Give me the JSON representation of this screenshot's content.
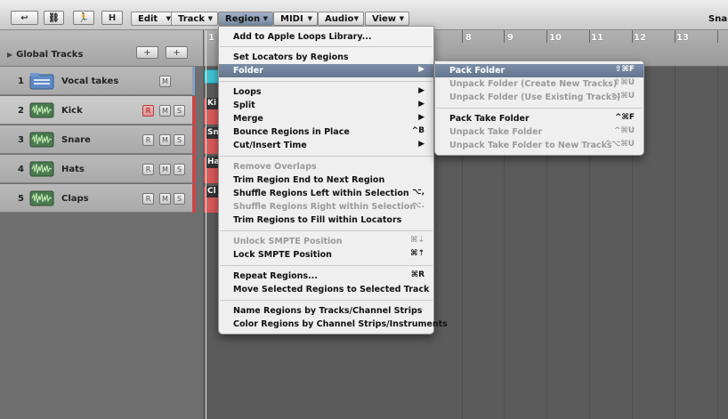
{
  "toolbar": {
    "buttons": [
      {
        "name": "back-button",
        "label": "↩"
      },
      {
        "name": "link-button",
        "label": "⛓"
      },
      {
        "name": "catch-button",
        "label": "🏃"
      },
      {
        "name": "hide-button",
        "label": "H"
      }
    ],
    "menus": [
      {
        "name": "menu-edit",
        "label": "Edit"
      },
      {
        "name": "menu-track",
        "label": "Track"
      },
      {
        "name": "menu-region",
        "label": "Region"
      },
      {
        "name": "menu-midi",
        "label": "MIDI"
      },
      {
        "name": "menu-audio",
        "label": "Audio"
      },
      {
        "name": "menu-view",
        "label": "View"
      }
    ],
    "snap_label": "Snap"
  },
  "global_tracks": {
    "label": "Global Tracks",
    "add_label": "+",
    "folder_add_label": "+"
  },
  "tracks": [
    {
      "num": "1",
      "name": "Vocal takes",
      "buttons": [
        "M"
      ]
    },
    {
      "num": "2",
      "name": "Kick",
      "buttons": [
        "R",
        "M",
        "S"
      ]
    },
    {
      "num": "3",
      "name": "Snare",
      "buttons": [
        "R",
        "M",
        "S"
      ]
    },
    {
      "num": "4",
      "name": "Hats",
      "buttons": [
        "R",
        "M",
        "S"
      ]
    },
    {
      "num": "5",
      "name": "Claps",
      "buttons": [
        "R",
        "M",
        "S"
      ]
    }
  ],
  "ruler": {
    "bars": [
      "1",
      "8",
      "9",
      "10",
      "11",
      "12",
      "13"
    ]
  },
  "regions": [
    {
      "label": "Ki"
    },
    {
      "label": "Sn"
    },
    {
      "label": "Ha"
    },
    {
      "label": "Cl"
    }
  ],
  "region_menu": {
    "items": [
      {
        "label": "Add to Apple Loops Library...",
        "shortcut": "",
        "disabled": false
      },
      {
        "sep": true
      },
      {
        "label": "Set Locators by Regions",
        "shortcut": "",
        "disabled": false
      },
      {
        "label": "Folder",
        "shortcut": "▶",
        "disabled": false,
        "highlight": true
      },
      {
        "sep": true
      },
      {
        "label": "Loops",
        "shortcut": "▶",
        "disabled": false
      },
      {
        "label": "Split",
        "shortcut": "▶",
        "disabled": false
      },
      {
        "label": "Merge",
        "shortcut": "▶",
        "disabled": false
      },
      {
        "label": "Bounce Regions in Place",
        "shortcut": "^B",
        "disabled": false
      },
      {
        "label": "Cut/Insert Time",
        "shortcut": "▶",
        "disabled": false
      },
      {
        "sep": true
      },
      {
        "label": "Remove Overlaps",
        "shortcut": "",
        "disabled": true
      },
      {
        "label": "Trim Region End to Next Region",
        "shortcut": "",
        "disabled": false
      },
      {
        "label": "Shuffle Regions Left within Selection",
        "shortcut": "⌥,",
        "disabled": false
      },
      {
        "label": "Shuffle Regions Right within Selection",
        "shortcut": "⌥.",
        "disabled": true
      },
      {
        "label": "Trim Regions to Fill within Locators",
        "shortcut": "",
        "disabled": false
      },
      {
        "sep": true
      },
      {
        "label": "Unlock SMPTE Position",
        "shortcut": "⌘⇣",
        "disabled": true
      },
      {
        "label": "Lock SMPTE Position",
        "shortcut": "⌘⇡",
        "disabled": false
      },
      {
        "sep": true
      },
      {
        "label": "Repeat Regions...",
        "shortcut": "⌘R",
        "disabled": false
      },
      {
        "label": "Move Selected Regions to Selected Track",
        "shortcut": "",
        "disabled": false
      },
      {
        "sep": true
      },
      {
        "label": "Name Regions by Tracks/Channel Strips",
        "shortcut": "",
        "disabled": false
      },
      {
        "label": "Color Regions by Channel Strips/Instruments",
        "shortcut": "",
        "disabled": false
      }
    ]
  },
  "folder_menu": {
    "items": [
      {
        "label": "Pack Folder",
        "shortcut": "⇧⌘F",
        "disabled": false,
        "highlight": true
      },
      {
        "label": "Unpack Folder (Create New Tracks)",
        "shortcut": "⇧⌘U",
        "disabled": true
      },
      {
        "label": "Unpack Folder (Use Existing Tracks)",
        "shortcut": "⌥⌘U",
        "disabled": true
      },
      {
        "sep": true
      },
      {
        "label": "Pack Take Folder",
        "shortcut": "^⌘F",
        "disabled": false
      },
      {
        "label": "Unpack Take Folder",
        "shortcut": "^⌘U",
        "disabled": true
      },
      {
        "label": "Unpack Take Folder to New Tracks",
        "shortcut": "^⌥⌘U",
        "disabled": true
      }
    ]
  },
  "colors": {
    "highlight": "#6f819b",
    "record_red": "#e06060",
    "region_cyan": "#3ec3d0",
    "region_red": "#d85a5a",
    "track_edge_blue": "#8aa0c0",
    "track_edge_red": "#d04444"
  }
}
